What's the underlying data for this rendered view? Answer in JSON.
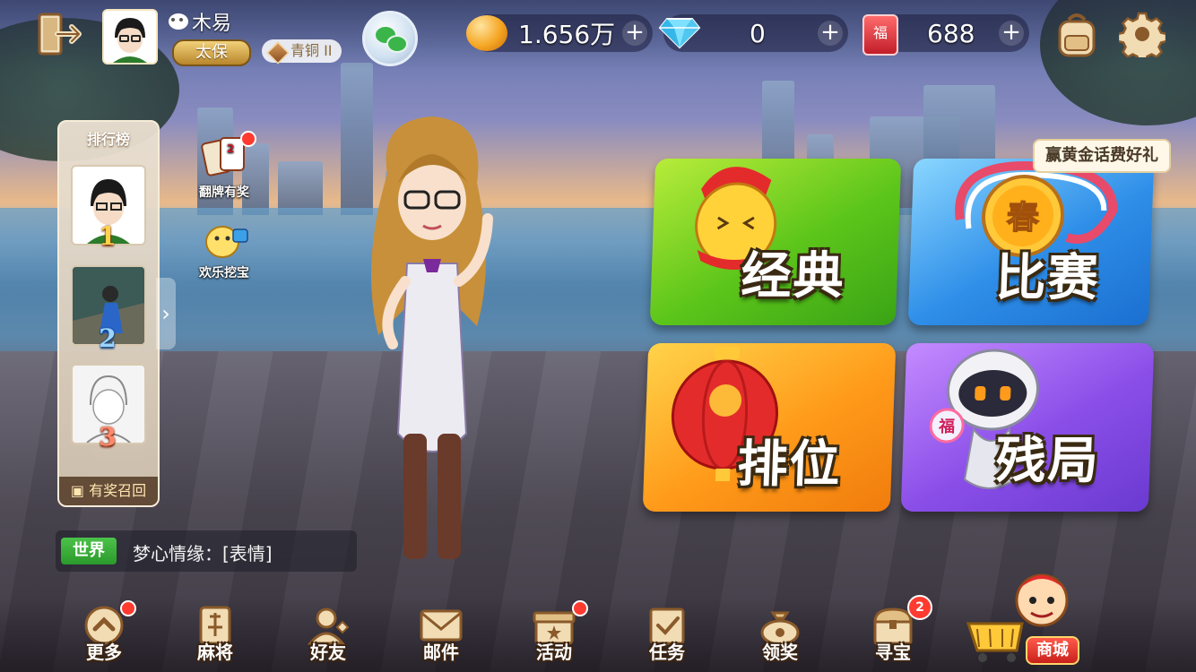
{
  "player": {
    "name": "木易",
    "title_badge": "太保",
    "rank_badge": "青铜 II"
  },
  "currency": {
    "beans": "1.656万",
    "diamonds": "0",
    "coupons": "688",
    "coupon_symbol": "福",
    "plus": "+"
  },
  "leaderboard": {
    "title": "排行榜",
    "ranks": [
      "1",
      "2",
      "3"
    ],
    "footer": "有奖召回",
    "arrow": "›"
  },
  "side_events": [
    {
      "label": "翻牌有奖",
      "icon": "card-flip-icon"
    },
    {
      "label": "欢乐挖宝",
      "icon": "treasure-dig-icon"
    }
  ],
  "modes": {
    "classic": "经典",
    "match": "比赛",
    "ranked": "排位",
    "endgame": "残局",
    "match_tip": "赢黄金话费好礼",
    "spring_char": "春",
    "fu_char": "福"
  },
  "chat": {
    "channel": "世界",
    "message": "梦心情缘：[表情]"
  },
  "bottom_nav": [
    {
      "label": "更多",
      "icon": "more-icon",
      "dot": true
    },
    {
      "label": "麻将",
      "icon": "mahjong-icon",
      "dot": false
    },
    {
      "label": "好友",
      "icon": "friends-icon",
      "dot": false
    },
    {
      "label": "邮件",
      "icon": "mail-icon",
      "dot": false
    },
    {
      "label": "活动",
      "icon": "gift-icon",
      "dot": true
    },
    {
      "label": "任务",
      "icon": "task-icon",
      "dot": false
    },
    {
      "label": "领奖",
      "icon": "reward-bag-icon",
      "dot": false
    },
    {
      "label": "寻宝",
      "icon": "treasure-chest-icon",
      "count": "2"
    },
    {
      "label": "商城",
      "icon": "shop-cart-icon",
      "dot": false
    }
  ],
  "colors": {
    "accent_gold": "#f2d17a",
    "classic_green": "#5cc51a",
    "match_blue": "#2e8ee8",
    "ranked_orange": "#ff9a1a",
    "endgame_purple": "#8a4ee8",
    "alert_red": "#ff3b30"
  }
}
